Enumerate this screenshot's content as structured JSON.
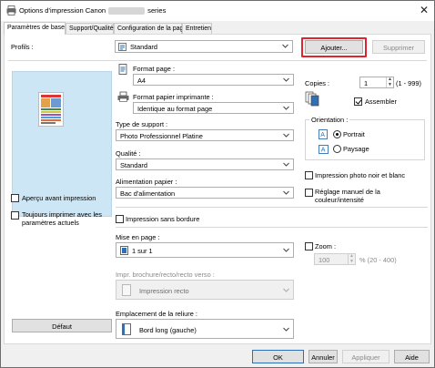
{
  "window": {
    "title_prefix": "Options d'impression Canon",
    "title_suffix": "series"
  },
  "tabs": [
    {
      "label": "Paramètres de base"
    },
    {
      "label": "Support/Qualité"
    },
    {
      "label": "Configuration de la page"
    },
    {
      "label": "Entretien"
    }
  ],
  "profiles": {
    "label": "Profils :",
    "value": "Standard",
    "add_label": "Ajouter...",
    "delete_label": "Supprimer"
  },
  "page_format": {
    "label": "Format page :",
    "value": "A4"
  },
  "printer_paper": {
    "label": "Format papier imprimante :",
    "value": "Identique au format page"
  },
  "media_type": {
    "label": "Type de support :",
    "value": "Photo Professionnel Platine"
  },
  "quality": {
    "label": "Qualité :",
    "value": "Standard"
  },
  "paper_source": {
    "label": "Alimentation papier :",
    "value": "Bac d'alimentation"
  },
  "borderless": {
    "label": "Impression sans bordure",
    "checked": false
  },
  "layout": {
    "label": "Mise en page :",
    "value": "1 sur 1"
  },
  "booklet": {
    "label": "Impr. brochure/recto/recto verso :",
    "value": "Impression recto"
  },
  "binding": {
    "label": "Emplacement de la reliure :",
    "value": "Bord long (gauche)"
  },
  "copies": {
    "label": "Copies :",
    "value": "1",
    "range": "(1 - 999)"
  },
  "collate": {
    "label": "Assembler",
    "checked": true
  },
  "orientation": {
    "label": "Orientation :",
    "portrait": "Portrait",
    "landscape": "Paysage",
    "selected": "Portrait"
  },
  "bw_photo": {
    "label": "Impression photo noir et blanc",
    "checked": false
  },
  "manual_color": {
    "label": "Réglage manuel de la couleur/intensité",
    "checked": false
  },
  "zoom": {
    "label": "Zoom :",
    "checked": false,
    "value": "100",
    "range": "% (20 - 400)"
  },
  "preview_options": {
    "print_preview": "Aperçu avant impression",
    "always_current": "Toujours imprimer avec les paramètres actuels"
  },
  "default_label": "Défaut",
  "footer": {
    "ok": "OK",
    "cancel": "Annuler",
    "apply": "Appliquer",
    "help": "Aide"
  },
  "colors": {
    "highlight": "#e0242c",
    "preview_bg": "#cde6f5"
  }
}
